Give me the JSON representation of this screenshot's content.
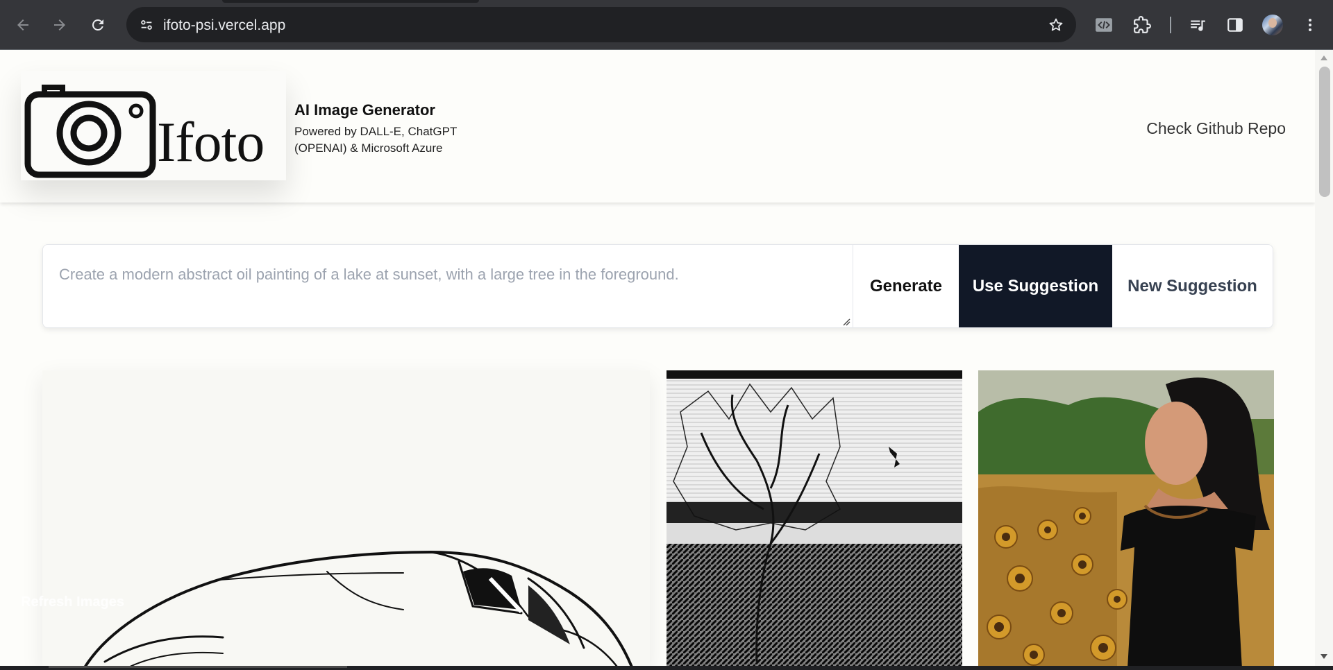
{
  "browser": {
    "url": "ifoto-psi.vercel.app",
    "accent": "#35363a"
  },
  "header": {
    "logo_text": "Ifoto",
    "title": "AI Image Generator",
    "subtitle": "Powered by DALL-E, ChatGPT (OPENAI) & Microsoft Azure",
    "github_link": "Check Github Repo"
  },
  "prompt": {
    "placeholder": "Create a modern abstract oil painting of a lake at sunset, with a large tree in the foreground.",
    "value": ""
  },
  "buttons": {
    "generate": "Generate",
    "use_suggestion": "Use Suggestion",
    "new_suggestion": "New Suggestion",
    "use_suggestion_bg": "#111827"
  },
  "gallery": {
    "overlay_text": "Refresh Images",
    "images": [
      {
        "name": "car-sketch"
      },
      {
        "name": "tree-ink"
      },
      {
        "name": "woman-sunflowers"
      }
    ]
  }
}
